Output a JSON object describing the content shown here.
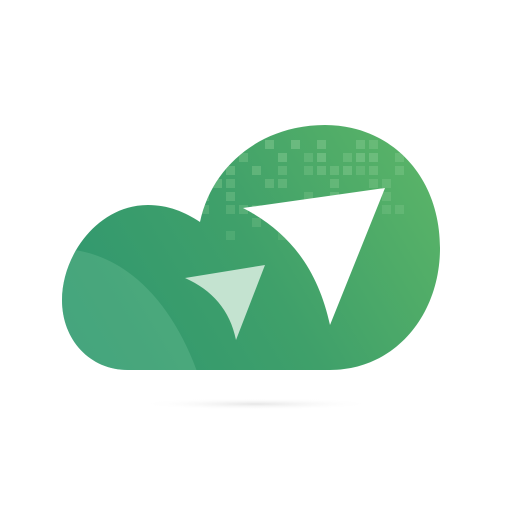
{
  "logo": {
    "name": "cloud-paper-plane-logo",
    "colors": {
      "background": "#ffffff",
      "cloud_light": "#5cb567",
      "cloud_mid": "#3fa06a",
      "cloud_dark": "#2e9670",
      "highlight": "#6fbf98",
      "plane_front": "#ffffff",
      "plane_back": "#c4e3d0",
      "grid_squares": "#8fcf98",
      "shadow": "#e6e6e6"
    },
    "icons": {
      "cloud": "cloud-icon",
      "plane": "paper-plane-icon",
      "grid": "pixel-grid-pattern"
    }
  }
}
